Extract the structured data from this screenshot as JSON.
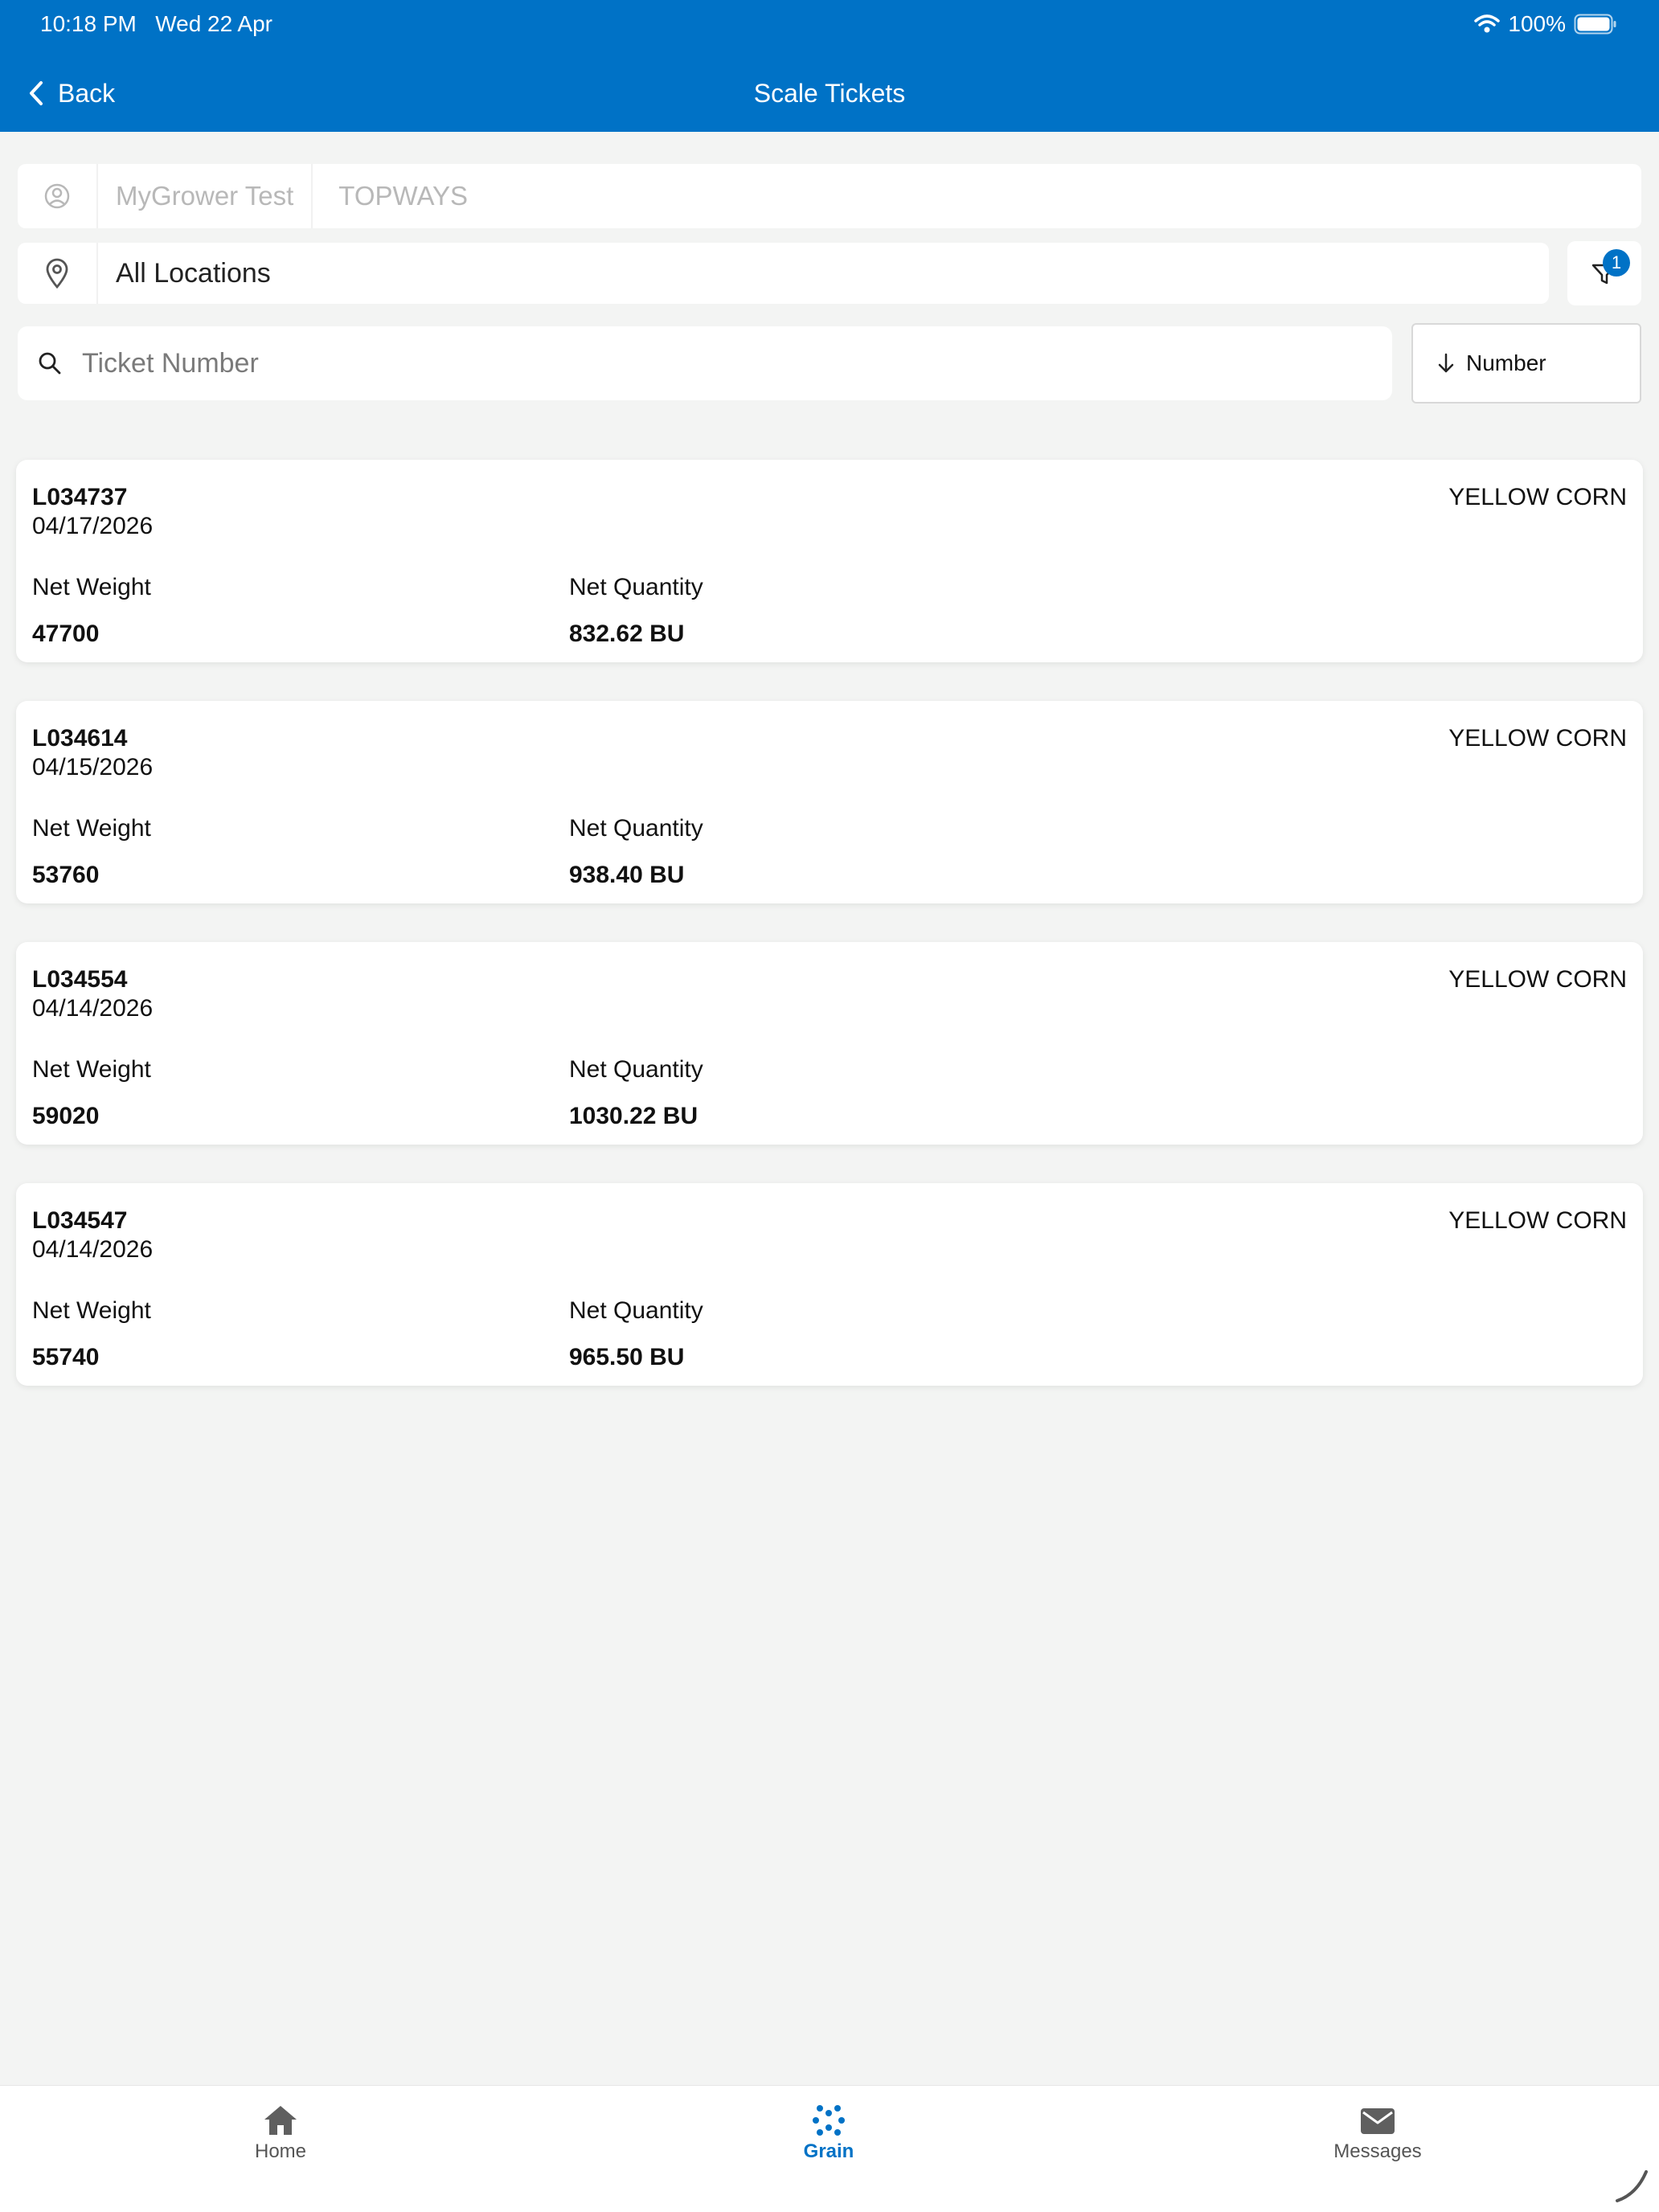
{
  "status_bar": {
    "time": "10:18 PM",
    "date": "Wed 22 Apr",
    "battery": "100%"
  },
  "nav": {
    "back_label": "Back",
    "title": "Scale Tickets"
  },
  "selector": {
    "grower": "MyGrower Test",
    "organization": "TOPWAYS",
    "location": "All Locations"
  },
  "filter": {
    "badge_count": "1"
  },
  "search": {
    "placeholder": "Ticket Number"
  },
  "sort": {
    "label": "Number",
    "direction": "descending"
  },
  "tickets": [
    {
      "number": "L034737",
      "date": "04/17/2026",
      "commodity": "YELLOW CORN",
      "net_weight_label": "Net Weight",
      "net_weight": "47700",
      "net_quantity_label": "Net Quantity",
      "net_quantity": "832.62 BU"
    },
    {
      "number": "L034614",
      "date": "04/15/2026",
      "commodity": "YELLOW CORN",
      "net_weight_label": "Net Weight",
      "net_weight": "53760",
      "net_quantity_label": "Net Quantity",
      "net_quantity": "938.40 BU"
    },
    {
      "number": "L034554",
      "date": "04/14/2026",
      "commodity": "YELLOW CORN",
      "net_weight_label": "Net Weight",
      "net_weight": "59020",
      "net_quantity_label": "Net Quantity",
      "net_quantity": "1030.22 BU"
    },
    {
      "number": "L034547",
      "date": "04/14/2026",
      "commodity": "YELLOW CORN",
      "net_weight_label": "Net Weight",
      "net_weight": "55740",
      "net_quantity_label": "Net Quantity",
      "net_quantity": "965.50 BU"
    }
  ],
  "tabs": [
    {
      "label": "Home",
      "icon": "home-icon"
    },
    {
      "label": "Grain",
      "icon": "grain-icon",
      "active": true
    },
    {
      "label": "Messages",
      "icon": "mail-icon"
    }
  ],
  "colors": {
    "brand": "#0072c6",
    "background": "#f3f4f3"
  }
}
